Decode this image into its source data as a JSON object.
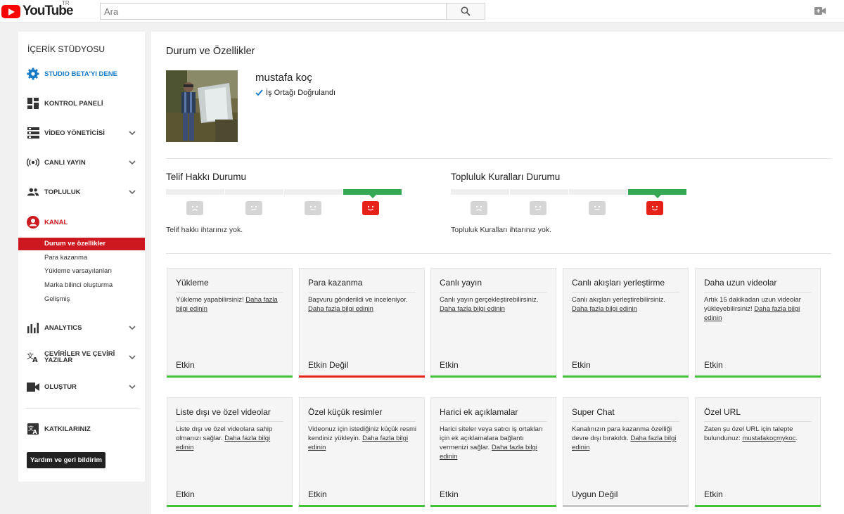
{
  "header": {
    "logo_text": "YouTube",
    "logo_country": "TR",
    "search_placeholder": "Ara",
    "icons": [
      "search-icon",
      "video-camera-icon"
    ]
  },
  "sidebar": {
    "title": "İÇERİK STÜDYOSU",
    "items": [
      {
        "label": "STUDIO BETA'YI DENE",
        "icon": "gear-icon"
      },
      {
        "label": "KONTROL PANELİ",
        "icon": "dashboard-icon"
      },
      {
        "label": "VİDEO YÖNETİCİSİ",
        "icon": "video-manager-icon"
      },
      {
        "label": "CANLI YAYIN",
        "icon": "live-broadcast-icon"
      },
      {
        "label": "TOPLULUK",
        "icon": "community-icon"
      },
      {
        "label": "KANAL",
        "icon": "channel-icon"
      },
      {
        "label": "ANALYTICS",
        "icon": "analytics-icon"
      },
      {
        "label_line1": "ÇEVİRİLER VE ÇEVİRİ",
        "label_line2": "YAZILAR",
        "icon": "translate-icon"
      },
      {
        "label": "OLUŞTUR",
        "icon": "create-icon"
      },
      {
        "label": "KATKILARINIZ",
        "icon": "contributions-icon"
      }
    ],
    "kanal_sub": [
      "Durum ve özellikler",
      "Para kazanma",
      "Yükleme varsayılanları",
      "Marka bilinci oluşturma",
      "Gelişmiş"
    ],
    "help_button": "Yardım ve geri bildirim",
    "accent_color": "#cc181e"
  },
  "main": {
    "title": "Durum ve Özellikler",
    "channel_name": "mustafa koç",
    "verified_text": "İş Ortağı Doğrulandı",
    "copyright": {
      "title": "Telif Hakkı Durumu",
      "text": "Telif hakkı ihtarınız yok.",
      "level": 4,
      "levels": 4
    },
    "community": {
      "title": "Topluluk Kuralları Durumu",
      "text": "Topluluk Kuralları ihtarınız yok.",
      "level": 4,
      "levels": 4
    },
    "features": [
      {
        "title": "Yükleme",
        "desc": "Yükleme yapabilirsiniz!",
        "link": "Daha fazla bilgi edinin",
        "status": "Etkin",
        "bar": "green"
      },
      {
        "title": "Para kazanma",
        "desc": "Başvuru gönderildi ve inceleniyor.",
        "link": "Daha fazla bilgi edinin",
        "status": "Etkin Değil",
        "bar": "red"
      },
      {
        "title": "Canlı yayın",
        "desc": "Canlı yayın gerçekleştirebilirsiniz.",
        "link": "Daha fazla bilgi edinin",
        "status": "Etkin",
        "bar": "green"
      },
      {
        "title": "Canlı akışları yerleştirme",
        "desc": "Canlı akışları yerleştirebilirsiniz.",
        "link": "Daha fazla bilgi edinin",
        "status": "Etkin",
        "bar": "green"
      },
      {
        "title": "Daha uzun videolar",
        "desc": "Artık 15 dakikadan uzun videolar yükleyebilirsiniz!",
        "link": "Daha fazla bilgi edinin",
        "status": "Etkin",
        "bar": "green"
      },
      {
        "title": "Liste dışı ve özel videolar",
        "desc": "Liste dışı ve özel videolara sahip olmanızı sağlar.",
        "link": "Daha fazla bilgi edinin",
        "status": "Etkin",
        "bar": "green"
      },
      {
        "title": "Özel küçük resimler",
        "desc": "Videonuz için istediğiniz küçük resmi kendiniz yükleyin.",
        "link": "Daha fazla bilgi edinin",
        "status": "Etkin",
        "bar": "green"
      },
      {
        "title": "Harici ek açıklamalar",
        "desc": "Harici siteler veya satıcı iş ortakları için ek açıklamalara bağlantı vermenizi sağlar.",
        "link": "Daha fazla bilgi edinin",
        "status": "Etkin",
        "bar": "green"
      },
      {
        "title": "Super Chat",
        "desc": "Kanalınızın para kazanma özelliği devre dışı bırakıldı.",
        "link": "Daha fazla bilgi edinin",
        "status": "Uygun Değil",
        "bar": "gray"
      },
      {
        "title": "Özel URL",
        "desc": "Zaten şu özel URL için talepte bulundunuz:",
        "link": "mustafakoçmykoc",
        "suffix": ".",
        "status": "Etkin",
        "bar": "green"
      }
    ]
  }
}
